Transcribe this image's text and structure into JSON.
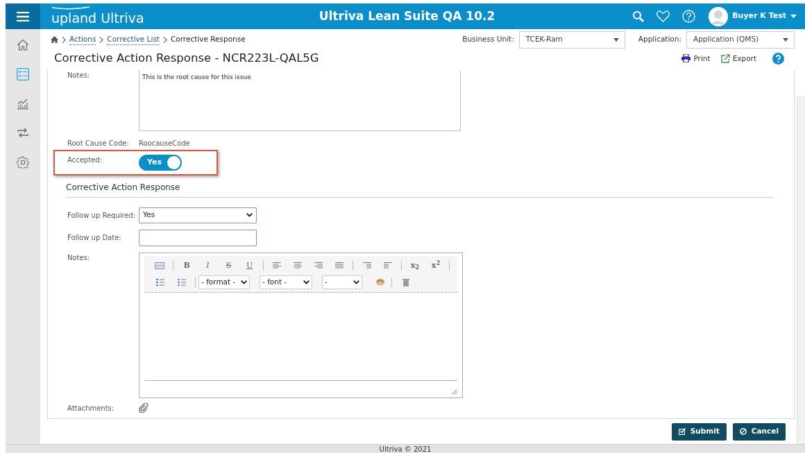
{
  "header": {
    "logo_brand": "upland",
    "logo_product": "Ultriva",
    "title": "Ultriva Lean Suite QA 10.2",
    "user": "Buyer K Test"
  },
  "sidebar": {
    "items": [
      {
        "selected": false
      },
      {
        "selected": true
      },
      {
        "selected": false
      },
      {
        "selected": false
      },
      {
        "selected": false
      }
    ]
  },
  "breadcrumb": [
    "Actions",
    "Corrective List",
    "Corrective Response"
  ],
  "page_title": "Corrective Action Response - NCR223L-QAL5G",
  "filters": [
    {
      "label": "Business Unit:",
      "value": "TCEK-Ram"
    },
    {
      "label": "Application:",
      "value": "Application (QMS)"
    }
  ],
  "actions": [
    "Print",
    "Export"
  ],
  "root_cause": {
    "notes_label": "Notes:",
    "notes": "This is the root cause for this issue",
    "code_label": "Root Cause Code:",
    "code": "RoocauseCode",
    "accepted_label": "Accepted:",
    "accepted_on": true,
    "accepted_text": "Yes",
    "highlighted": true
  },
  "response": {
    "heading": "Corrective Action Response",
    "follow_up_required_label": "Follow up Required:",
    "follow_up_required": "Yes",
    "follow_up_date_label": "Follow up Date:",
    "notes_label": "Notes:",
    "attachments_label": "Attachments:",
    "editor": {
      "style_buttons": [
        "B",
        "I",
        "S",
        "U"
      ],
      "script_buttons": [
        "x$_{2}$",
        "x$^{2}$"
      ],
      "selects": [
        "- format -",
        "- font -",
        "-"
      ]
    }
  },
  "buttons": [
    "Submit",
    "Cancel"
  ],
  "footer": "Ultriva © 2021"
}
